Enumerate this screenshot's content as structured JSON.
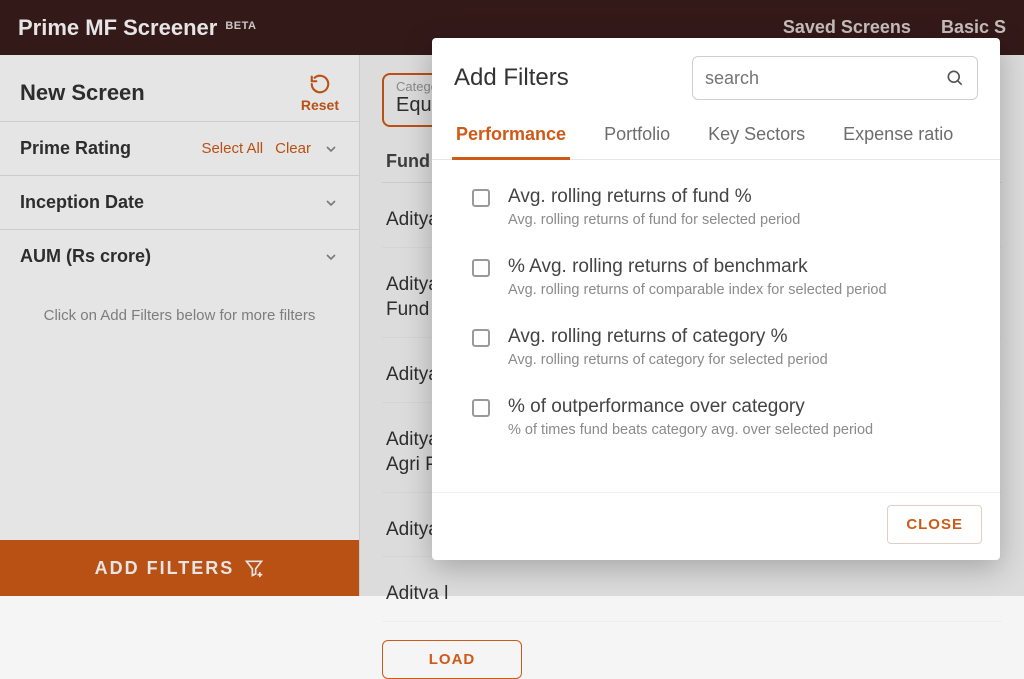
{
  "header": {
    "title": "Prime MF Screener",
    "badge": "BETA",
    "right_links": [
      "Saved Screens",
      "Basic S"
    ]
  },
  "sidebar": {
    "new_screen": "New Screen",
    "reset_label": "Reset",
    "rows": [
      {
        "label": "Prime Rating",
        "select_all": "Select All",
        "clear": "Clear"
      },
      {
        "label": "Inception Date"
      },
      {
        "label": "AUM (Rs crore)"
      }
    ],
    "helper": "Click on Add Filters below for more filters",
    "add_filters": "ADD FILTERS"
  },
  "main": {
    "category_label": "Catego",
    "category_value": "Equit",
    "fund_header": "Fund Na",
    "rows": [
      "Aditya",
      "Aditya l\nFund",
      "Aditya l",
      "Aditya l\nAgri Pla",
      "Aditya l",
      "Aditva l"
    ],
    "load_more": "LOAD"
  },
  "modal": {
    "title": "Add Filters",
    "search_placeholder": "search",
    "tabs": [
      "Performance",
      "Portfolio",
      "Key Sectors",
      "Expense ratio"
    ],
    "active_tab": 0,
    "filters": [
      {
        "label": "Avg. rolling returns of fund %",
        "desc": "Avg. rolling returns of fund for selected period"
      },
      {
        "label": "% Avg. rolling returns of benchmark",
        "desc": "Avg. rolling returns of comparable index for selected period"
      },
      {
        "label": "Avg. rolling returns of category %",
        "desc": "Avg. rolling returns of category for selected period"
      },
      {
        "label": "% of outperformance over category",
        "desc": "% of times fund beats category avg. over selected period"
      }
    ],
    "close": "CLOSE"
  }
}
